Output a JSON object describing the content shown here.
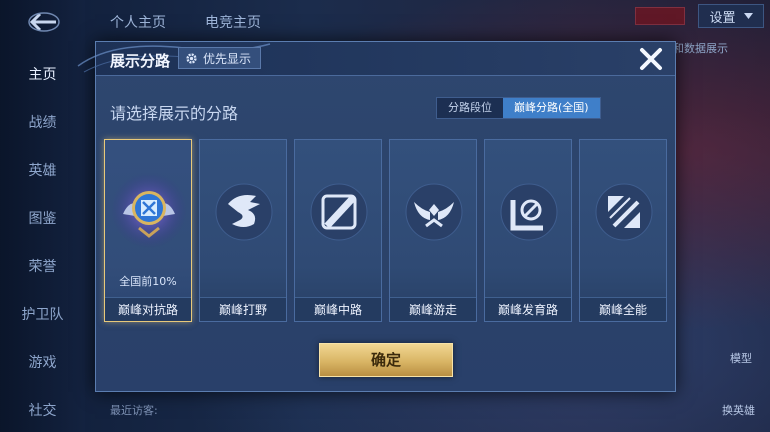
{
  "background": {
    "nav": [
      "主页",
      "战绩",
      "英雄",
      "图鉴",
      "荣誉",
      "护卫队",
      "游戏",
      "社交"
    ],
    "top_tabs": [
      "个人主页",
      "电竞主页"
    ],
    "settings_label": "设置",
    "right_text": "和数据展示",
    "side_labels": [
      "模型",
      "换英雄"
    ],
    "bottom_hint": "最近访客:"
  },
  "modal": {
    "title": "展示分路",
    "priority_label": "优先显示",
    "prompt": "请选择展示的分路",
    "segments": [
      "分路段位",
      "巅峰分路(全国)"
    ],
    "selected_segment": 1,
    "cards": [
      {
        "label": "巅峰对抗路",
        "icon": "clash-lane-emblem-icon",
        "rank": "全国前10%",
        "selected": true
      },
      {
        "label": "巅峰打野",
        "icon": "jungle-dragon-icon"
      },
      {
        "label": "巅峰中路",
        "icon": "mid-lane-icon"
      },
      {
        "label": "巅峰游走",
        "icon": "roam-wings-icon"
      },
      {
        "label": "巅峰发育路",
        "icon": "farm-lane-icon"
      },
      {
        "label": "巅峰全能",
        "icon": "all-round-icon"
      }
    ],
    "confirm_label": "确定"
  },
  "colors": {
    "accent_gold": "#e8c97a",
    "segment_active": "#3f7fc9",
    "modal_bg": "#2e4770"
  }
}
